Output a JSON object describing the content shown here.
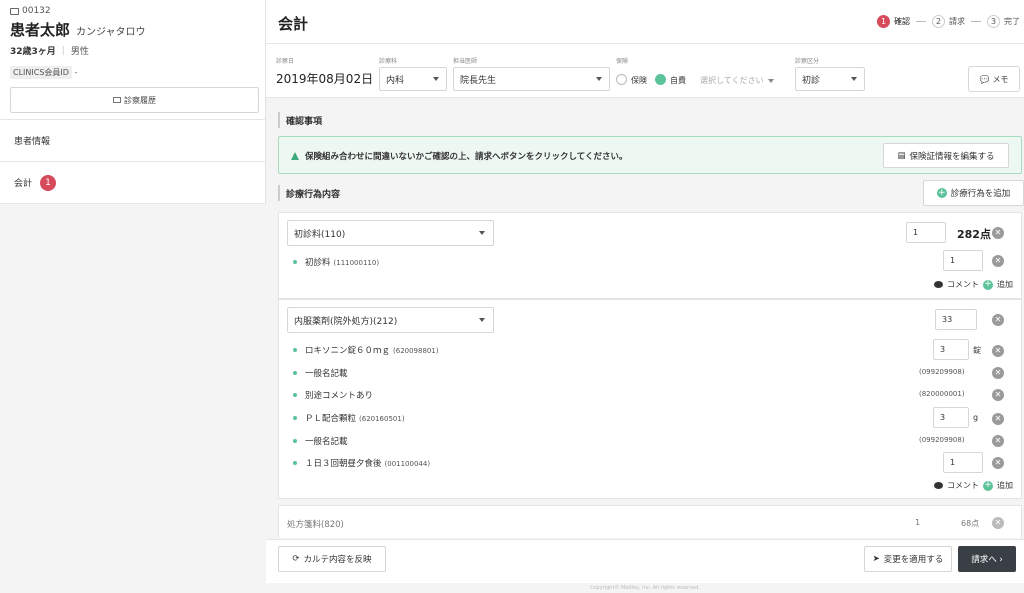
{
  "patient": {
    "id": "00132",
    "name": "患者太郎",
    "kana": "カンジャタロウ",
    "age": "32歳3ヶ月",
    "sex": "男性",
    "member_label": "CLINICS会員ID",
    "member_value": "-",
    "history_button": "診察履歴"
  },
  "sidebar": {
    "items": [
      {
        "label": "患者情報"
      },
      {
        "label": "会計",
        "badge": "1"
      }
    ]
  },
  "header": {
    "title": "会計",
    "steps": [
      {
        "num": "1",
        "label": "確認"
      },
      {
        "num": "2",
        "label": "請求"
      },
      {
        "num": "3",
        "label": "完了"
      }
    ]
  },
  "form": {
    "date_label": "診察日",
    "date_value": "2019年08月02日",
    "dept_label": "診療科",
    "dept_value": "内科",
    "doctor_label": "担当医師",
    "doctor_value": "院長先生",
    "insurance_label": "保険",
    "insurance_opt1": "保険",
    "insurance_opt2": "自費",
    "insurance_placeholder": "選択してください",
    "category_label": "診察区分",
    "category_value": "初診",
    "memo_button": "メモ"
  },
  "confirm": {
    "title": "確認事項",
    "alert_text": "保険組み合わせに間違いないかご確認の上、請求へボタンをクリックしてください。",
    "edit_insurance_button": "保険証情報を編集する"
  },
  "acts": {
    "title": "診療行為内容",
    "add_button": "診療行為を追加",
    "comment_label": "コメント",
    "add_label": "追加",
    "blocks": [
      {
        "name": "初診料(110)",
        "qty": "1",
        "points": "282点",
        "items": [
          {
            "label": "初診料",
            "code": "(111000110)",
            "qty": "1"
          }
        ]
      },
      {
        "name": "内服薬剤(院外処方)(212)",
        "qty": "33",
        "items": [
          {
            "label": "ロキソニン錠６０ｍｇ",
            "code": "(620098801)",
            "qty": "3",
            "unit": "錠"
          },
          {
            "label": "一般名記載",
            "rcode": "(099209908)"
          },
          {
            "label": "別途コメントあり",
            "rcode": "(820000001)"
          },
          {
            "label": "ＰＬ配合顆粒",
            "code": "(620160501)",
            "qty": "3",
            "unit": "g"
          },
          {
            "label": "一般名記載",
            "rcode": "(099209908)"
          },
          {
            "label": "１日３回朝昼夕食後",
            "code": "(001100044)",
            "qty": "1"
          }
        ]
      },
      {
        "name": "処方箋料(820)",
        "qty": "1",
        "points": "68点"
      }
    ]
  },
  "footer": {
    "reflect_button": "カルテ内容を反映",
    "apply_button": "変更を適用する",
    "bill_button": "請求へ ›",
    "copyright": "Copyright© Medley, Inc. All rights reserved."
  }
}
